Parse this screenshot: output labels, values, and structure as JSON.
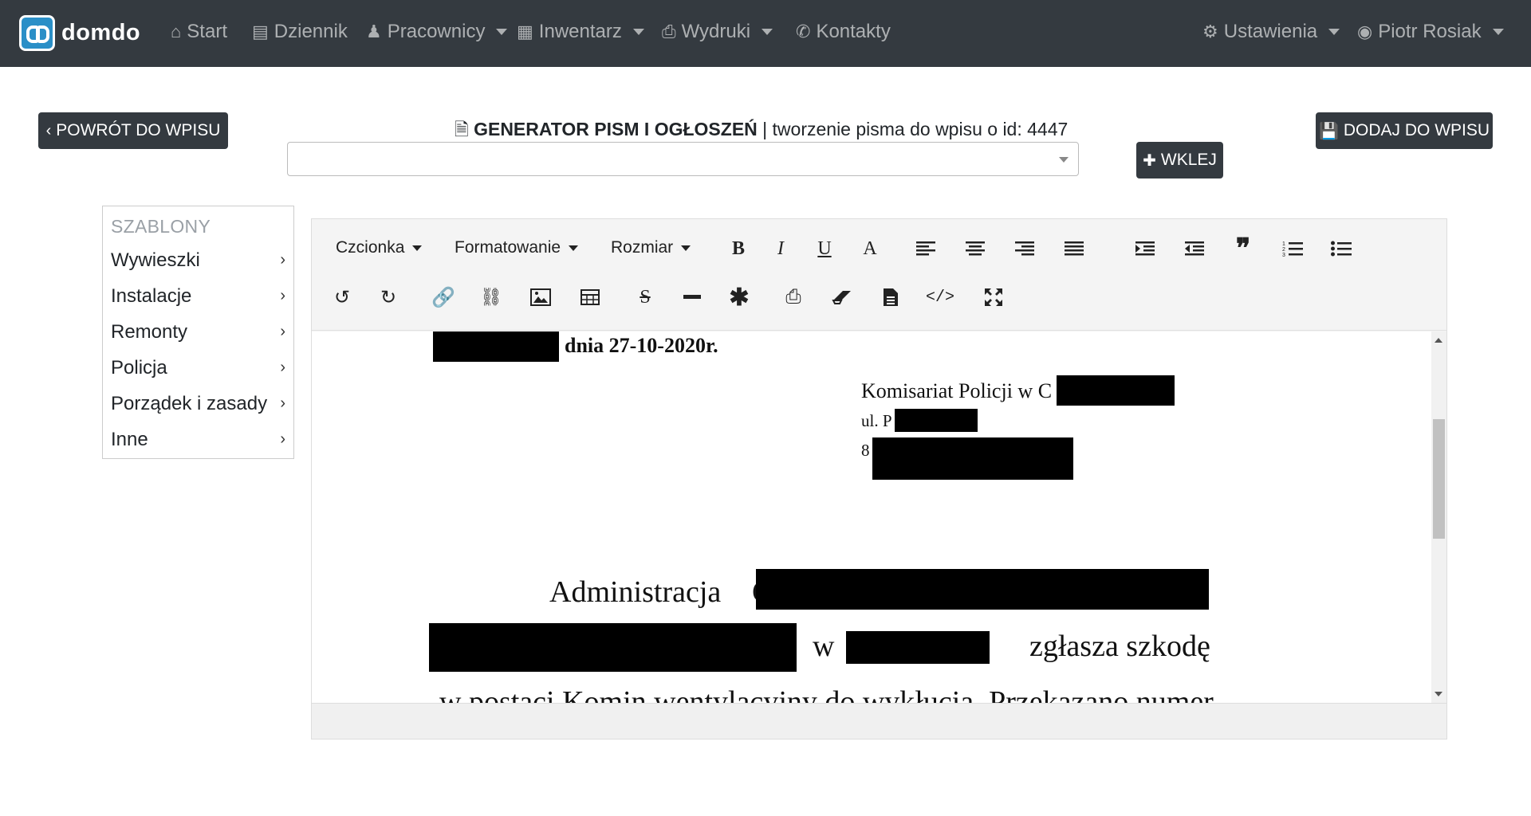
{
  "navbar": {
    "brand": "domdo",
    "items": [
      {
        "icon": "home-icon",
        "glyph": "⌂",
        "label": "Start",
        "dropdown": false
      },
      {
        "icon": "book-icon",
        "glyph": "▤",
        "label": "Dziennik",
        "dropdown": false
      },
      {
        "icon": "person-icon",
        "glyph": "♟",
        "label": "Pracownicy",
        "dropdown": true
      },
      {
        "icon": "building-icon",
        "glyph": "▦",
        "label": "Inwentarz",
        "dropdown": true
      },
      {
        "icon": "print-icon",
        "glyph": "⎙",
        "label": "Wydruki",
        "dropdown": true
      },
      {
        "icon": "phone-icon",
        "glyph": "✆",
        "label": "Kontakty",
        "dropdown": false
      }
    ],
    "settings": {
      "icon": "gear-icon",
      "glyph": "⚙",
      "label": "Ustawienia"
    },
    "user": {
      "icon": "user-circle-icon",
      "glyph": "◉",
      "label": "Piotr Rosiak"
    }
  },
  "header": {
    "back_button": "POWRÓT DO WPISU",
    "title_bold": "GENERATOR PISM I OGŁOSZEŃ",
    "title_rest": " | tworzenie pisma do wpisu o id: 4447",
    "select_value": "",
    "paste_button": "WKLEJ",
    "add_button": "DODAJ DO WPISU"
  },
  "sidebar": {
    "heading": "SZABLONY",
    "items": [
      {
        "label": "Wywieszki"
      },
      {
        "label": "Instalacje"
      },
      {
        "label": "Remonty"
      },
      {
        "label": "Policja"
      },
      {
        "label": "Porządek i zasady"
      },
      {
        "label": "Inne"
      }
    ]
  },
  "toolbar": {
    "font_label": "Czcionka",
    "format_label": "Formatowanie",
    "size_label": "Rozmiar"
  },
  "document": {
    "date_line": "dnia 27-10-2020r.",
    "addressee_line1": "Komisariat Policji w C",
    "addressee_line2": "ul. P",
    "addressee_line3": "8",
    "body_line1_start": "Administracja",
    "body_line1_c": "C",
    "body_line2_w": "w",
    "body_line2_end": "zgłasza  szkodę",
    "body_line3": "w  postaci  Komin wentylacyjny do wykłucia. Przekazano numer"
  }
}
